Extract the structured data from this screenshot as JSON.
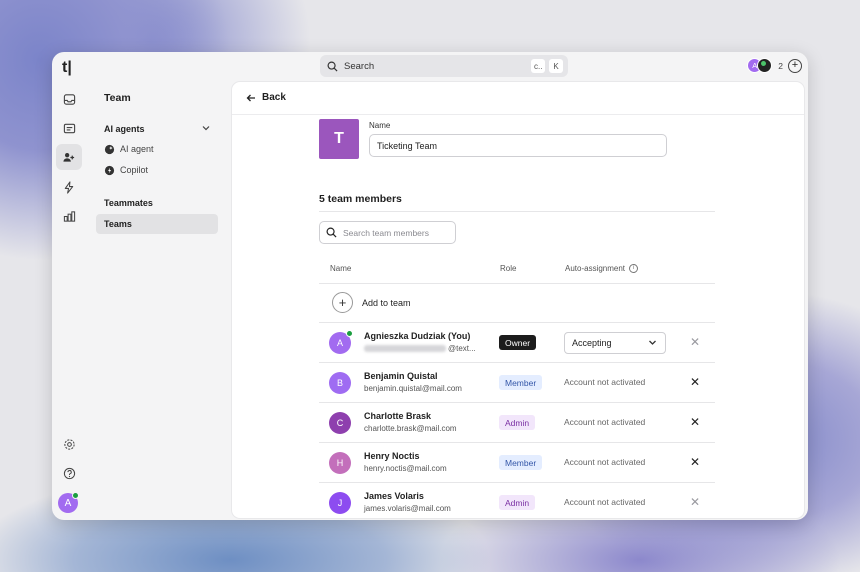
{
  "app": {
    "logo": "t|"
  },
  "topbar": {
    "search_label": "Search",
    "shortcut_keys": [
      "c..",
      "K"
    ],
    "presence_avatar_letter": "A",
    "presence_count": "2",
    "add_label": "+"
  },
  "rail": {
    "items": [
      "inbox-icon",
      "contacts-icon",
      "team-icon",
      "automation-icon",
      "reports-icon"
    ],
    "bottom": [
      "settings-icon",
      "help-icon"
    ],
    "user_avatar": "A"
  },
  "sidebar": {
    "title": "Team",
    "sections": [
      {
        "label": "AI agents",
        "items": [
          "AI agent",
          "Copilot"
        ]
      },
      {
        "label": "Teammates",
        "items": [
          "Teams"
        ]
      }
    ]
  },
  "panel": {
    "back_label": "Back",
    "team_avatar_letter": "T",
    "name_label": "Name",
    "name_value": "Ticketing Team",
    "members_title": "5 team members",
    "search_placeholder": "Search team members",
    "columns": {
      "name": "Name",
      "role": "Role",
      "auto": "Auto-assignment"
    },
    "add_label": "Add to team",
    "members": [
      {
        "initial": "A",
        "name": "Agnieszka Dudziak (You)",
        "email": "@text...",
        "role": "Owner",
        "auto": "Accepting",
        "color": "#a26bf0",
        "online": true
      },
      {
        "initial": "B",
        "name": "Benjamin Quistal",
        "email": "benjamin.quistal@mail.com",
        "role": "Member",
        "auto": "Account not activated",
        "color": "#9f6cf2"
      },
      {
        "initial": "C",
        "name": "Charlotte Brask",
        "email": "charlotte.brask@mail.com",
        "role": "Admin",
        "auto": "Account not activated",
        "color": "#8e3fae"
      },
      {
        "initial": "H",
        "name": "Henry Noctis",
        "email": "henry.noctis@mail.com",
        "role": "Member",
        "auto": "Account not activated",
        "color": "#c36fbb"
      },
      {
        "initial": "J",
        "name": "James Volaris",
        "email": "james.volaris@mail.com",
        "role": "Admin",
        "auto": "Account not activated",
        "color": "#8d4cf0"
      }
    ]
  },
  "colors": {
    "accent": "#9b56bd",
    "owner_badge": "#1c1c1c",
    "member_badge": "#e4edff",
    "admin_badge": "#f2e6fb",
    "online": "#1a9e3f"
  }
}
